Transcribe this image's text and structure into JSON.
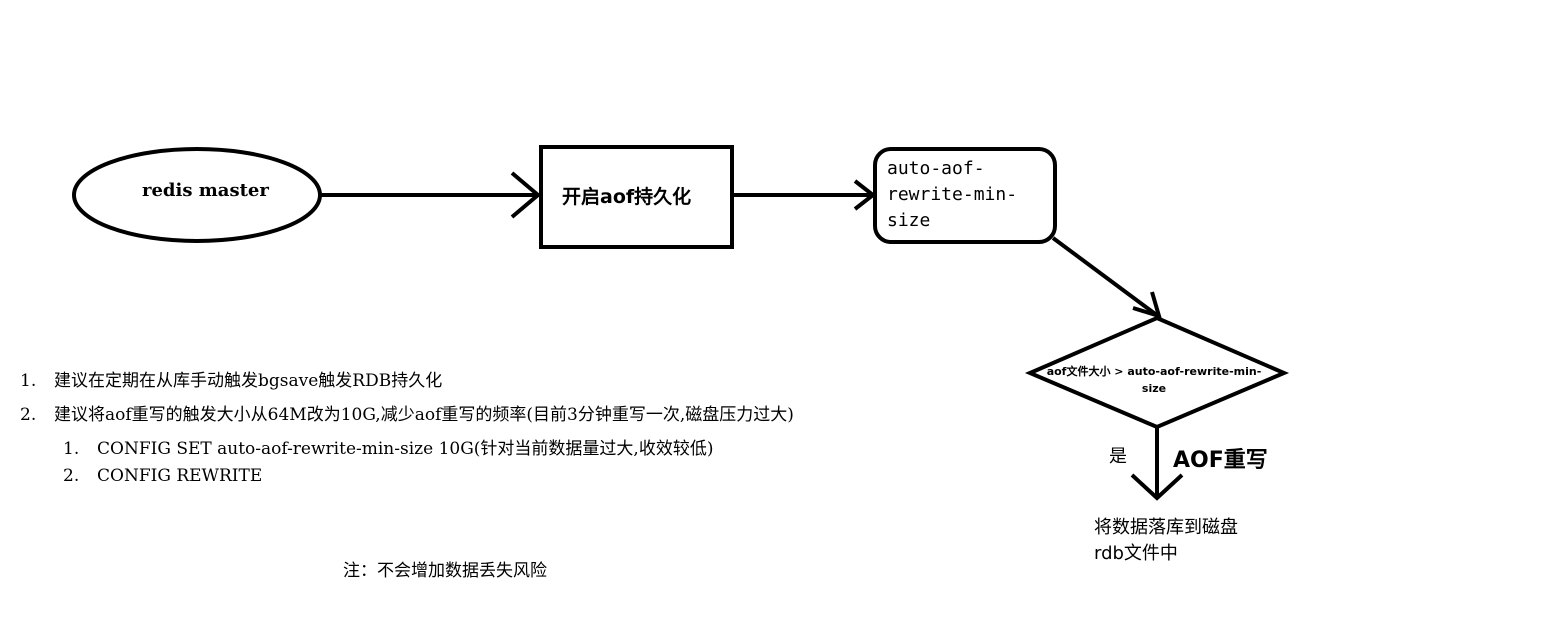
{
  "nodes": {
    "redis_master": "redis master",
    "enable_aof": "开启aof持久化",
    "min_size": [
      "auto-aof-",
      "rewrite-min-",
      "size"
    ],
    "condition": "aof文件大小 > auto-aof-rewrite-min-size",
    "result": "将数据落库到磁盘rdb文件中"
  },
  "edges": {
    "yes": "是",
    "aof_rewrite": "AOF重写"
  },
  "notes": {
    "items": [
      {
        "num": "1.",
        "text": "建议在定期在从库手动触发bgsave触发RDB持久化"
      },
      {
        "num": "2.",
        "text": "建议将aof重写的触发大小从64M改为10G,减少aof重写的频率(目前3分钟重写一次,磁盘压力过大)"
      }
    ],
    "subitems": [
      {
        "num": "1.",
        "text": "CONFIG SET auto-aof-rewrite-min-size 10G(针对当前数据量过大,收效较低)"
      },
      {
        "num": "2.",
        "text": "CONFIG REWRITE"
      }
    ],
    "footnote": "注：不会增加数据丢失风险"
  }
}
